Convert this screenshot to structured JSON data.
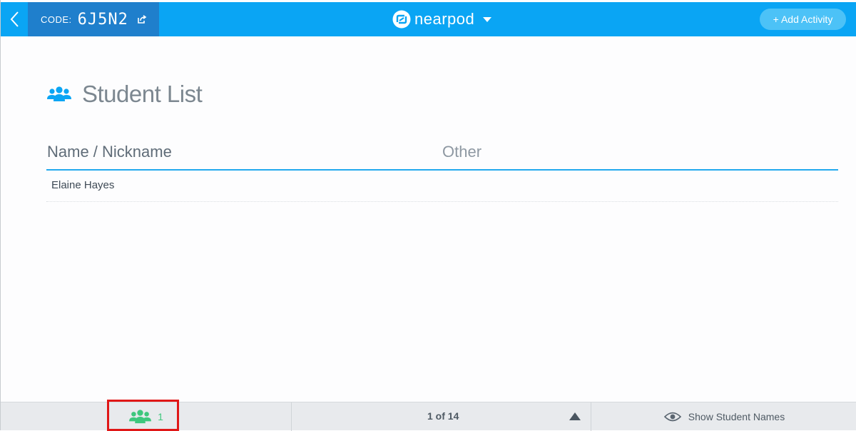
{
  "topbar": {
    "code_label": "CODE:",
    "code_value": "6J5N2",
    "brand": "nearpod",
    "add_activity_label": "+ Add Activity"
  },
  "main": {
    "title": "Student List",
    "columns": [
      "Name / Nickname",
      "Other"
    ],
    "rows": [
      {
        "name": "Elaine Hayes",
        "other": ""
      }
    ]
  },
  "footer": {
    "student_count": "1",
    "pager": "1 of 14",
    "show_names_label": "Show Student Names"
  },
  "colors": {
    "topbar": "#0aa5f4",
    "code_box": "#1f7fcc",
    "accent_line": "#22a9ee",
    "students_green": "#3ec77d",
    "highlight": "#e01717"
  }
}
